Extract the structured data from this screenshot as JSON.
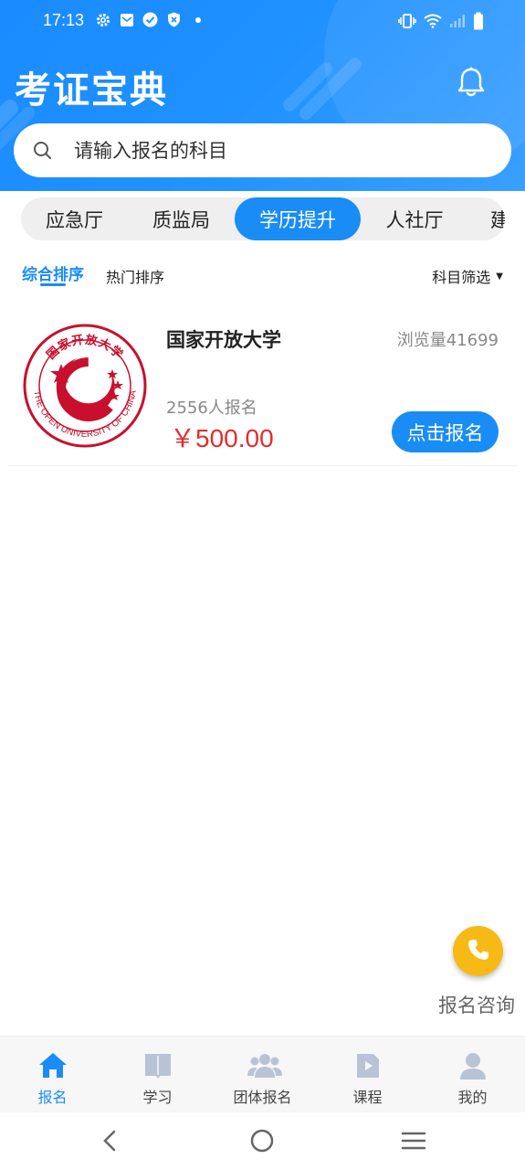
{
  "status_bar": {
    "time": "17:13"
  },
  "header": {
    "app_title": "考证宝典",
    "search_placeholder": "请输入报名的科目"
  },
  "category_tabs": [
    {
      "label": "应急厅",
      "active": false
    },
    {
      "label": "质监局",
      "active": false
    },
    {
      "label": "学历提升",
      "active": true
    },
    {
      "label": "人社厅",
      "active": false
    },
    {
      "label": "建",
      "active": false
    }
  ],
  "sort_bar": {
    "comprehensive": "综合排序",
    "hot": "热门排序",
    "filter": "科目筛选"
  },
  "courses": [
    {
      "name": "国家开放大学",
      "views": "浏览量41699",
      "enrolled": "2556人报名",
      "price": "￥500.00",
      "button": "点击报名",
      "logo": {
        "top_text": "国家开放大学",
        "ring_text": "THE OPEN UNIVERSITY OF CHINA",
        "color": "#c8102e"
      }
    }
  ],
  "consult": {
    "label": "报名咨询",
    "color": "#f7b916"
  },
  "bottom_nav": [
    {
      "label": "报名",
      "icon": "home-icon",
      "active": true
    },
    {
      "label": "学习",
      "icon": "book-icon",
      "active": false
    },
    {
      "label": "团体报名",
      "icon": "group-icon",
      "active": false
    },
    {
      "label": "课程",
      "icon": "video-icon",
      "active": false
    },
    {
      "label": "我的",
      "icon": "user-icon",
      "active": false
    }
  ],
  "colors": {
    "primary": "#1a8cf5",
    "price": "#e02e2e",
    "inactive_icon": "#b8c4d6"
  }
}
